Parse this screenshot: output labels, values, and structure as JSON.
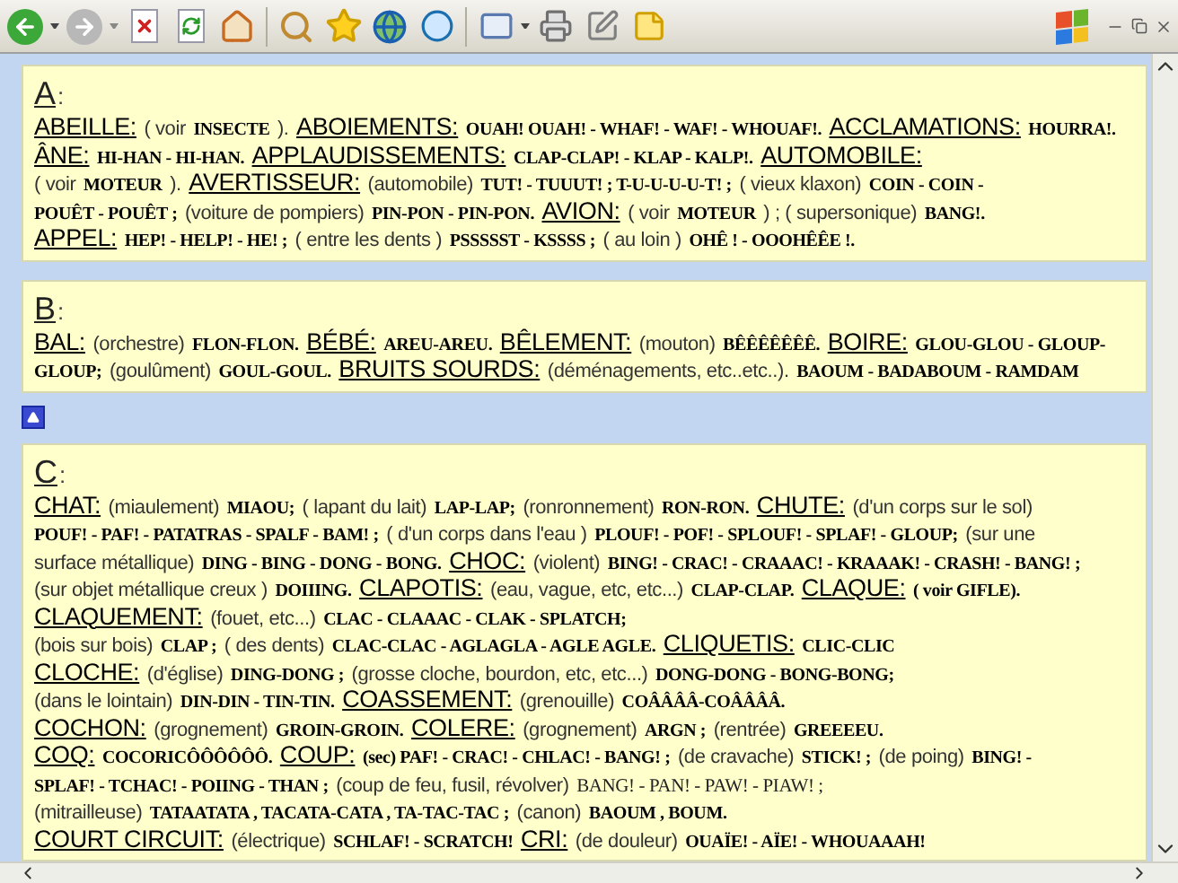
{
  "sections": [
    {
      "letter": "A",
      "mark": ":",
      "lines": [
        [
          {
            "kind": "head",
            "text": "ABEILLE:"
          },
          {
            "kind": "note",
            "text": "( voir"
          },
          {
            "kind": "sound",
            "text": "INSECTE"
          },
          {
            "kind": "note",
            "text": ")."
          },
          {
            "kind": "head",
            "text": "ABOIEMENTS:"
          },
          {
            "kind": "sound",
            "text": "OUAH! OUAH! - WHAF! - WAF! - WHOUAF!."
          },
          {
            "kind": "head",
            "text": "ACCLAMATIONS:"
          },
          {
            "kind": "sound",
            "text": "HOURRA!."
          }
        ],
        [
          {
            "kind": "head",
            "text": "ÂNE:"
          },
          {
            "kind": "sound",
            "text": "HI-HAN - HI-HAN."
          },
          {
            "kind": "head",
            "text": "APPLAUDISSEMENTS:"
          },
          {
            "kind": "sound",
            "text": "CLAP-CLAP! - KLAP - KALP!."
          },
          {
            "kind": "head",
            "text": "AUTOMOBILE:"
          }
        ],
        [
          {
            "kind": "note",
            "text": "( voir"
          },
          {
            "kind": "sound",
            "text": "MOTEUR"
          },
          {
            "kind": "note",
            "text": ")."
          },
          {
            "kind": "head",
            "text": "AVERTISSEUR:"
          },
          {
            "kind": "note",
            "text": "(automobile)"
          },
          {
            "kind": "sound",
            "text": "TUT! - TUUUT! ; T-U-U-U-U-T! ;"
          },
          {
            "kind": "note",
            "text": "( vieux klaxon)"
          },
          {
            "kind": "sound",
            "text": "COIN - COIN -"
          }
        ],
        [
          {
            "kind": "sound",
            "text": "POUÊT - POUÊT ;"
          },
          {
            "kind": "note",
            "text": "(voiture de pompiers)"
          },
          {
            "kind": "sound",
            "text": "PIN-PON - PIN-PON."
          },
          {
            "kind": "head",
            "text": "AVION:"
          },
          {
            "kind": "note",
            "text": "( voir"
          },
          {
            "kind": "sound",
            "text": "MOTEUR"
          },
          {
            "kind": "note",
            "text": ") ; ( supersonique)"
          },
          {
            "kind": "sound",
            "text": "BANG!."
          }
        ],
        [
          {
            "kind": "head",
            "text": "APPEL:"
          },
          {
            "kind": "sound",
            "text": "HEP! - HELP! - HE! ;"
          },
          {
            "kind": "note",
            "text": "( entre les dents )"
          },
          {
            "kind": "sound",
            "text": "PSSSSST - KSSSS ;"
          },
          {
            "kind": "note",
            "text": "( au loin )"
          },
          {
            "kind": "sound",
            "text": "OHÊ ! - OOOHÊÊE !."
          }
        ]
      ]
    },
    {
      "letter": "B",
      "mark": ":",
      "lines": [
        [
          {
            "kind": "head",
            "text": "BAL:"
          },
          {
            "kind": "note",
            "text": "(orchestre)"
          },
          {
            "kind": "sound",
            "text": "FLON-FLON."
          },
          {
            "kind": "head",
            "text": "BÉBÉ:"
          },
          {
            "kind": "sound",
            "text": "AREU-AREU."
          },
          {
            "kind": "head",
            "text": "BÊLEMENT:"
          },
          {
            "kind": "note",
            "text": "(mouton)"
          },
          {
            "kind": "sound",
            "text": "BÊÊÊÊÊÊÊ."
          },
          {
            "kind": "head",
            "text": "BOIRE:"
          },
          {
            "kind": "sound",
            "text": "GLOU-GLOU - GLOUP-"
          }
        ],
        [
          {
            "kind": "sound",
            "text": "GLOUP;"
          },
          {
            "kind": "note",
            "text": "(goulûment)"
          },
          {
            "kind": "sound",
            "text": "GOUL-GOUL."
          },
          {
            "kind": "head",
            "text": "BRUITS SOURDS:"
          },
          {
            "kind": "note",
            "text": "(déménagements, etc..etc..)."
          },
          {
            "kind": "sound",
            "text": "BAOUM - BADABOUM - RAMDAM"
          }
        ]
      ]
    },
    {
      "letter": "C",
      "mark": ":",
      "lines": [
        [
          {
            "kind": "head",
            "text": "CHAT:"
          },
          {
            "kind": "note",
            "text": "(miaulement)"
          },
          {
            "kind": "sound",
            "text": "MIAOU;"
          },
          {
            "kind": "note",
            "text": "( lapant du lait)"
          },
          {
            "kind": "sound",
            "text": "LAP-LAP;"
          },
          {
            "kind": "note",
            "text": "(ronronnement)"
          },
          {
            "kind": "sound",
            "text": "RON-RON."
          },
          {
            "kind": "head",
            "text": "CHUTE:"
          },
          {
            "kind": "note",
            "text": "(d'un corps sur le sol)"
          }
        ],
        [
          {
            "kind": "sound",
            "text": "POUF! - PAF! - PATATRAS - SPALF - BAM! ;"
          },
          {
            "kind": "note",
            "text": "( d'un corps dans l'eau )"
          },
          {
            "kind": "sound",
            "text": "PLOUF! - POF! - SPLOUF! - SPLAF! - GLOUP;"
          },
          {
            "kind": "note",
            "text": "(sur une"
          }
        ],
        [
          {
            "kind": "note",
            "text": "surface métallique)"
          },
          {
            "kind": "sound",
            "text": "DING - BING - DONG - BONG."
          },
          {
            "kind": "head",
            "text": "CHOC:"
          },
          {
            "kind": "note",
            "text": "(violent)"
          },
          {
            "kind": "sound",
            "text": "BING! - CRAC! - CRAAAC! - KRAAAK! - CRASH! - BANG! ;"
          }
        ],
        [
          {
            "kind": "note",
            "text": "(sur objet métallique creux )"
          },
          {
            "kind": "sound",
            "text": "DOIIING."
          },
          {
            "kind": "head",
            "text": "CLAPOTIS:"
          },
          {
            "kind": "note",
            "text": "(eau, vague, etc, etc...)"
          },
          {
            "kind": "sound",
            "text": "CLAP-CLAP."
          },
          {
            "kind": "head",
            "text": "CLAQUE:"
          },
          {
            "kind": "sound",
            "text": "( voir GIFLE)."
          }
        ],
        [
          {
            "kind": "head",
            "text": "CLAQUEMENT:"
          },
          {
            "kind": "note",
            "text": "(fouet, etc...)"
          },
          {
            "kind": "sound",
            "text": "CLAC - CLAAAC - CLAK - SPLATCH;"
          }
        ],
        [
          {
            "kind": "note",
            "text": "(bois sur bois)"
          },
          {
            "kind": "sound",
            "text": "CLAP ;"
          },
          {
            "kind": "note",
            "text": "( des dents)"
          },
          {
            "kind": "sound",
            "text": "CLAC-CLAC - AGLAGLA - AGLE AGLE."
          },
          {
            "kind": "head",
            "text": "CLIQUETIS:"
          },
          {
            "kind": "sound",
            "text": "CLIC-CLIC"
          }
        ],
        [
          {
            "kind": "head",
            "text": "CLOCHE:"
          },
          {
            "kind": "note",
            "text": "(d'église)"
          },
          {
            "kind": "sound",
            "text": "DING-DONG ;"
          },
          {
            "kind": "note",
            "text": "(grosse cloche, bourdon, etc, etc...)"
          },
          {
            "kind": "sound",
            "text": "DONG-DONG - BONG-BONG;"
          }
        ],
        [
          {
            "kind": "note",
            "text": "(dans le lointain)"
          },
          {
            "kind": "sound",
            "text": "DIN-DIN - TIN-TIN."
          },
          {
            "kind": "head",
            "text": "COASSEMENT:"
          },
          {
            "kind": "note",
            "text": "(grenouille)"
          },
          {
            "kind": "sound",
            "text": "COÂÂÂÂ-COÂÂÂÂ."
          }
        ],
        [
          {
            "kind": "head",
            "text": "COCHON:"
          },
          {
            "kind": "note",
            "text": "(grognement)"
          },
          {
            "kind": "sound",
            "text": "GROIN-GROIN."
          },
          {
            "kind": "head",
            "text": "COLERE:"
          },
          {
            "kind": "note",
            "text": "(grognement)"
          },
          {
            "kind": "sound",
            "text": "ARGN ;"
          },
          {
            "kind": "note",
            "text": "(rentrée)"
          },
          {
            "kind": "sound",
            "text": "GREEEEU."
          }
        ],
        [
          {
            "kind": "head",
            "text": "COQ:"
          },
          {
            "kind": "sound",
            "text": "COCORICÔÔÔÔÔÔ."
          },
          {
            "kind": "head",
            "text": "COUP:"
          },
          {
            "kind": "sound",
            "text": "(sec) PAF! - CRAC! - CHLAC! - BANG! ;"
          },
          {
            "kind": "note",
            "text": "(de cravache)"
          },
          {
            "kind": "sound",
            "text": "STICK! ;"
          },
          {
            "kind": "note",
            "text": "(de poing)"
          },
          {
            "kind": "sound",
            "text": "BING! -"
          }
        ],
        [
          {
            "kind": "sound",
            "text": "SPLAF! - TCHAC! - POIING - THAN ;"
          },
          {
            "kind": "note",
            "text": "(coup de feu, fusil, révolver)"
          },
          {
            "kind": "plain",
            "text": "BANG! - PAN! - PAW! - PIAW! ;"
          }
        ],
        [
          {
            "kind": "note",
            "text": "(mitrailleuse)"
          },
          {
            "kind": "sound",
            "text": "TATAATATA , TACATA-CATA , TA-TAC-TAC ;"
          },
          {
            "kind": "note",
            "text": "(canon)"
          },
          {
            "kind": "sound",
            "text": "BAOUM , BOUM."
          }
        ],
        [
          {
            "kind": "head",
            "text": "COURT CIRCUIT:"
          },
          {
            "kind": "note",
            "text": "(électrique)"
          },
          {
            "kind": "sound",
            "text": "SCHLAF! - SCRATCH!"
          },
          {
            "kind": "head",
            "text": "CRI:"
          },
          {
            "kind": "note",
            "text": "(de douleur)"
          },
          {
            "kind": "sound",
            "text": "OUAÏE! - AÏE! - WHOUAAAH!"
          }
        ]
      ]
    }
  ]
}
